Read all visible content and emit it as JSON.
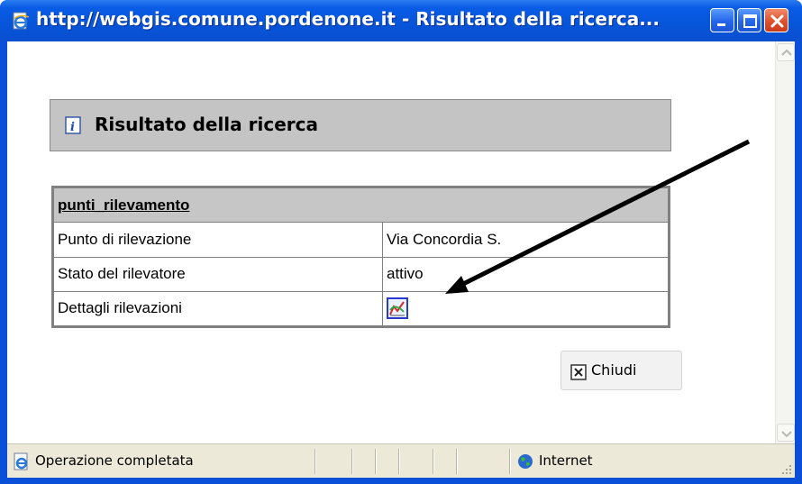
{
  "window": {
    "title": "http://webgis.comune.pordenone.it - Risultato della ricerca...",
    "icon": "ie-page-icon",
    "controls": [
      "minimize-icon",
      "maximize-icon",
      "close-icon"
    ]
  },
  "panel": {
    "icon": "info-icon",
    "title": "Risultato della ricerca"
  },
  "result_table": {
    "header": "punti_rilevamento",
    "rows": [
      {
        "label": "Punto di rilevazione",
        "value": "Via Concordia S."
      },
      {
        "label": "Stato del rilevatore",
        "value": "attivo"
      },
      {
        "label": "Dettagli rilevazioni",
        "value_icon": "chart-icon"
      }
    ]
  },
  "close_button": {
    "label": "Chiudi",
    "icon": "close-x-icon"
  },
  "status": {
    "text": "Operazione completata",
    "zone": "Internet"
  },
  "colors": {
    "titlebar": "#0654d8",
    "panel_bg": "#c4c4c4",
    "table_header_bg": "#c6c6c6",
    "statusbar_bg": "#ece9d8",
    "arrow": "#000000"
  }
}
